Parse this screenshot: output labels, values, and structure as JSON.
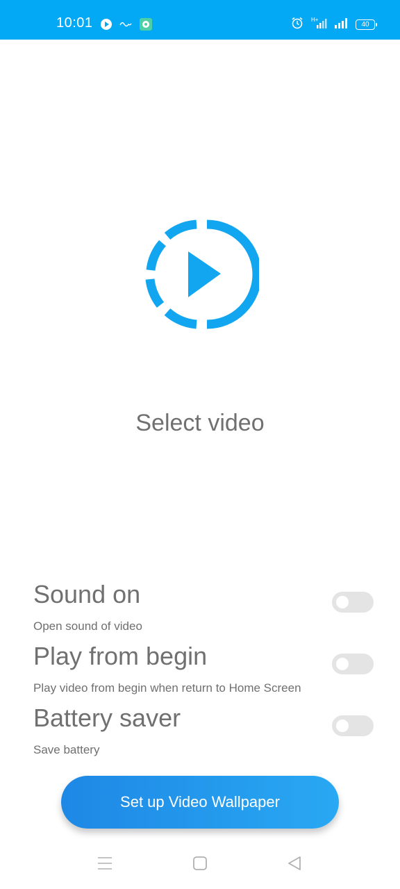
{
  "status_bar": {
    "time": "10:01",
    "left_icons": [
      "play-circle-icon",
      "app-notification-icon",
      "chat-bubble-icon"
    ],
    "right_icons": [
      "alarm-icon",
      "network-hplus-icon",
      "signal-icon"
    ],
    "battery": "40"
  },
  "main": {
    "picker_icon": "video-play-icon",
    "select_label": "Select video"
  },
  "settings": [
    {
      "title": "Sound on",
      "subtitle": "Open sound of video",
      "enabled": false
    },
    {
      "title": "Play from begin",
      "subtitle": "Play video from begin when return to Home Screen",
      "enabled": false
    },
    {
      "title": "Battery saver",
      "subtitle": "Save battery",
      "enabled": false
    }
  ],
  "action_button": {
    "label": "Set up Video Wallpaper"
  },
  "nav_bar": {
    "icons": [
      "menu-icon",
      "home-icon",
      "back-icon"
    ]
  },
  "colors": {
    "accent": "#03A9F4",
    "button_start": "#1E88E5",
    "button_end": "#29A8F3",
    "text_gray": "#707070"
  }
}
